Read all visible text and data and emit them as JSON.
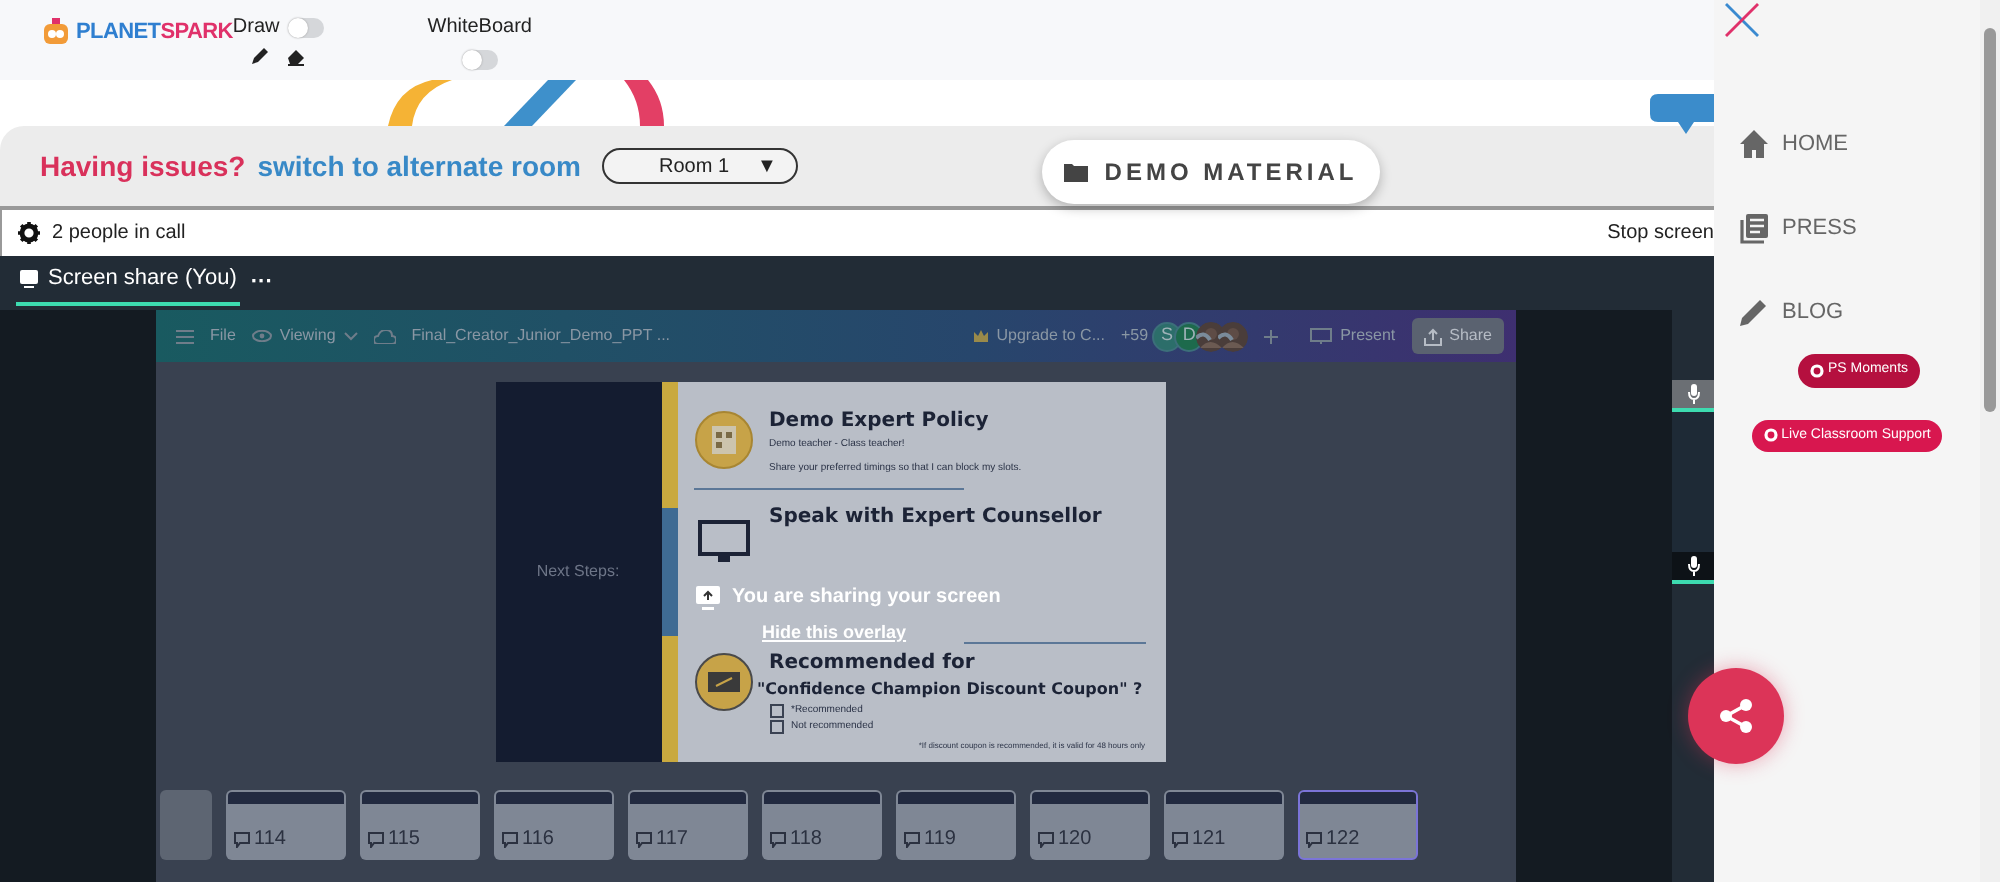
{
  "header": {
    "logo": {
      "first": "PLANET",
      "second": "SPARK"
    },
    "toggles": [
      {
        "label": "Draw",
        "on": false
      },
      {
        "label": "WhiteBoard",
        "on": false
      }
    ]
  },
  "issues_bar": {
    "prompt": "Having issues?",
    "link": "switch to alternate room",
    "room_select": {
      "value": "Room 1",
      "caret": "▼"
    }
  },
  "demo_material_button": "DEMO MATERIAL",
  "call_bar": {
    "people": "2 people in call",
    "stop": "Stop screen"
  },
  "share_tab": {
    "label": "Screen share (You)",
    "menu": "···",
    "selected": true
  },
  "shared_app": {
    "toolbar": {
      "file": "File",
      "viewing": "Viewing",
      "doc_title": "Final_Creator_Junior_Demo_PPT ...",
      "upgrade": "Upgrade to C...",
      "more_count": "+59",
      "avatars": [
        {
          "kind": "initial",
          "initial": "S",
          "color": "#2c6e6a"
        },
        {
          "kind": "initial",
          "initial": "D",
          "color": "#1d6a4c"
        },
        {
          "kind": "picture"
        },
        {
          "kind": "picture"
        }
      ],
      "present": "Present",
      "share": "Share"
    },
    "slide": {
      "side_title": "Next Steps:",
      "sections": [
        {
          "kind": "policy",
          "title": "Demo Expert Policy",
          "lines": [
            "Demo teacher - Class teacher!",
            "Share your preferred timings so that I can block my slots."
          ]
        },
        {
          "kind": "counsellor",
          "title": "Speak with Expert Counsellor"
        },
        {
          "kind": "coupon",
          "title": "Recommended for",
          "subtitle": "\"Confidence Champion Discount Coupon\" ?",
          "options": [
            {
              "label": "*Recommended",
              "checked": false
            },
            {
              "label": "Not recommended",
              "checked": false
            }
          ],
          "footnote": "*If discount coupon is recommended, it is valid for 48 hours only"
        }
      ]
    },
    "thumbnails": [
      {
        "number": "114",
        "selected": false
      },
      {
        "number": "115",
        "selected": false
      },
      {
        "number": "116",
        "selected": false
      },
      {
        "number": "117",
        "selected": false
      },
      {
        "number": "118",
        "selected": false
      },
      {
        "number": "119",
        "selected": false
      },
      {
        "number": "120",
        "selected": false
      },
      {
        "number": "121",
        "selected": false
      },
      {
        "number": "122",
        "selected": true
      }
    ]
  },
  "overlay": {
    "message": "You are sharing your screen",
    "hide_link": "Hide this overlay"
  },
  "sidebar": {
    "items": [
      {
        "kind": "home",
        "label": "HOME"
      },
      {
        "kind": "press",
        "label": "PRESS"
      },
      {
        "kind": "blog",
        "label": "BLOG"
      }
    ],
    "badges": [
      {
        "label": "PS Moments",
        "color": "#b5103f"
      },
      {
        "label": "Live Classroom Support",
        "color": "#d8174f"
      }
    ]
  }
}
